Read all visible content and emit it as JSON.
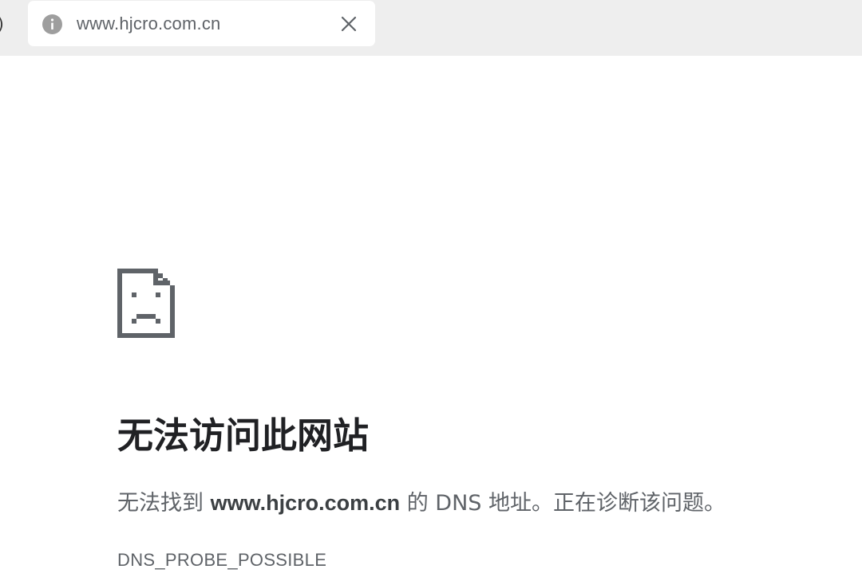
{
  "window": {
    "edge_glyph": ")"
  },
  "address_bar": {
    "icon": "info-icon",
    "url": "www.hjcro.com.cn",
    "close_icon": "close-icon"
  },
  "error": {
    "icon": "sad-page-icon",
    "title": "无法访问此网站",
    "message_prefix": "无法找到 ",
    "host": "www.hjcro.com.cn",
    "message_suffix": " 的 DNS 地址。正在诊断该问题。",
    "code": "DNS_PROBE_POSSIBLE"
  },
  "colors": {
    "chrome_background": "#eeeeee",
    "title_text": "#202124",
    "secondary_text": "#5f6368",
    "icon_gray": "#5f6368"
  }
}
